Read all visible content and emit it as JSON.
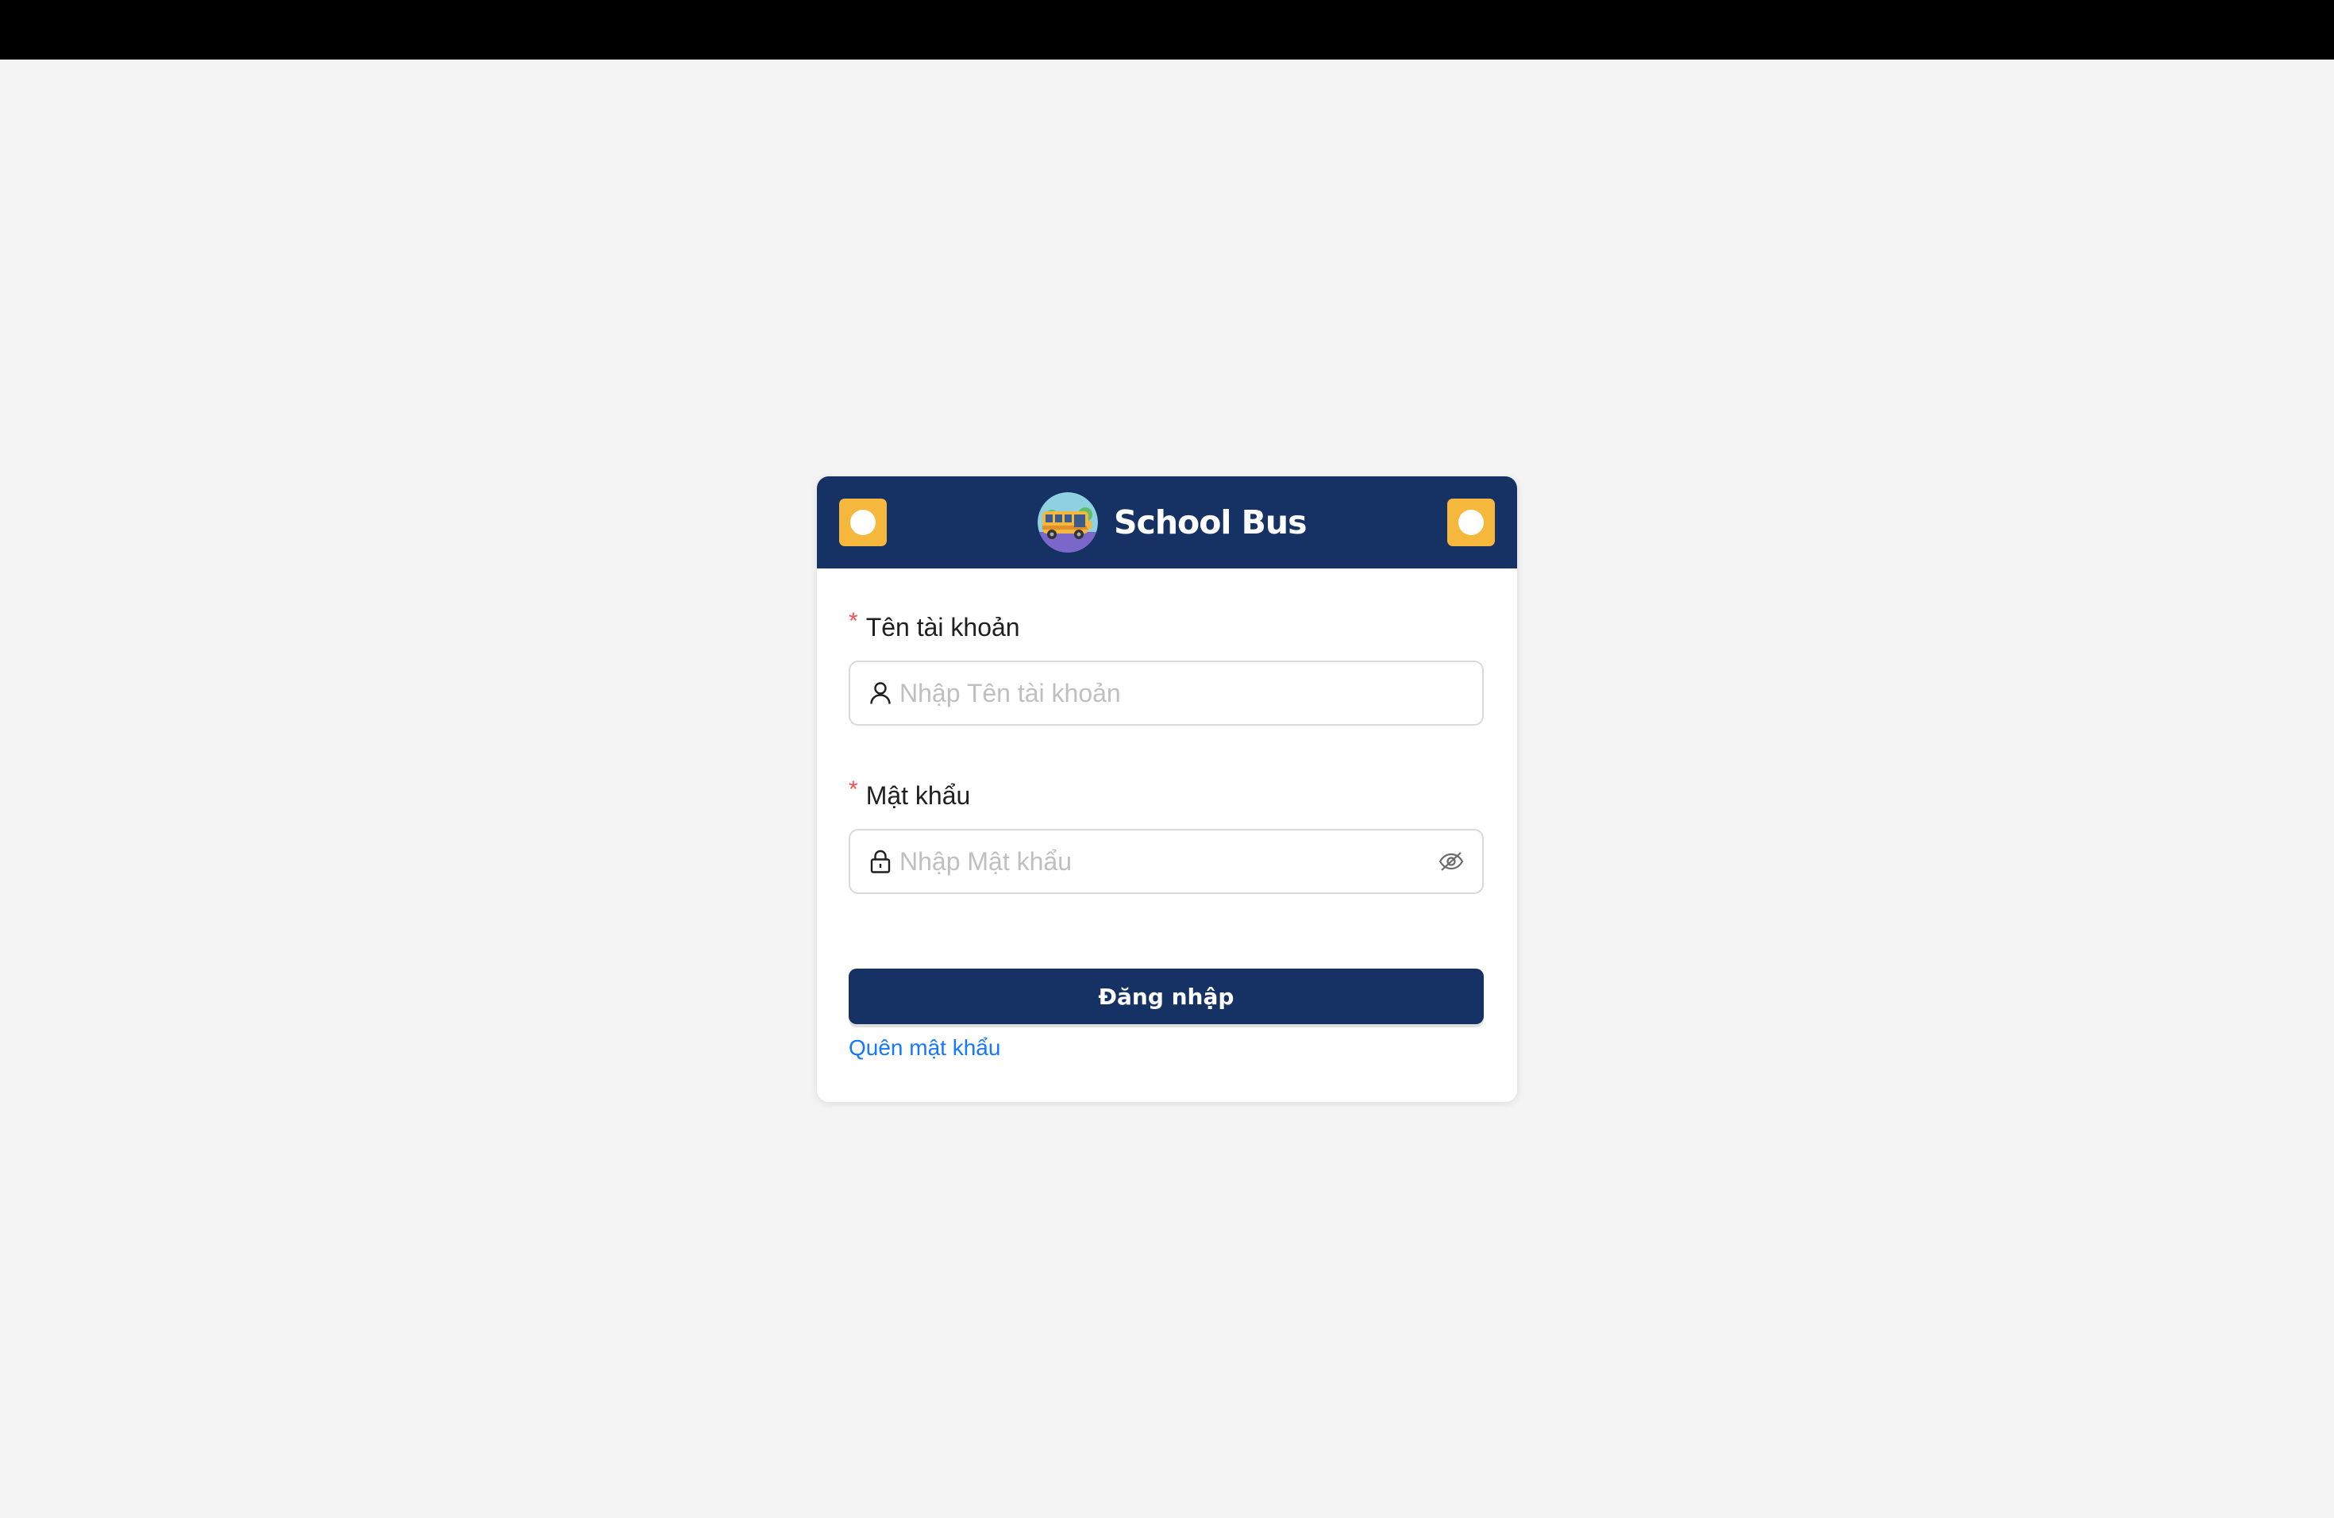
{
  "header": {
    "title": "School Bus",
    "logo": "school-bus-logo",
    "background": "#163163",
    "accent": "#f5b83d"
  },
  "form": {
    "username": {
      "required_mark": "*",
      "label": "Tên tài khoản",
      "placeholder": "Nhập Tên tài khoản",
      "value": "",
      "icon": "user-icon"
    },
    "password": {
      "required_mark": "*",
      "label": "Mật khẩu",
      "placeholder": "Nhập Mật khẩu",
      "value": "",
      "icon": "lock-icon",
      "toggle_icon": "eye-invisible-icon"
    },
    "submit_label": "Đăng nhập",
    "forgot_label": "Quên mật khẩu"
  },
  "colors": {
    "page_background": "#f4f4f4",
    "link": "#1677ff",
    "required": "#ff4d4f"
  }
}
